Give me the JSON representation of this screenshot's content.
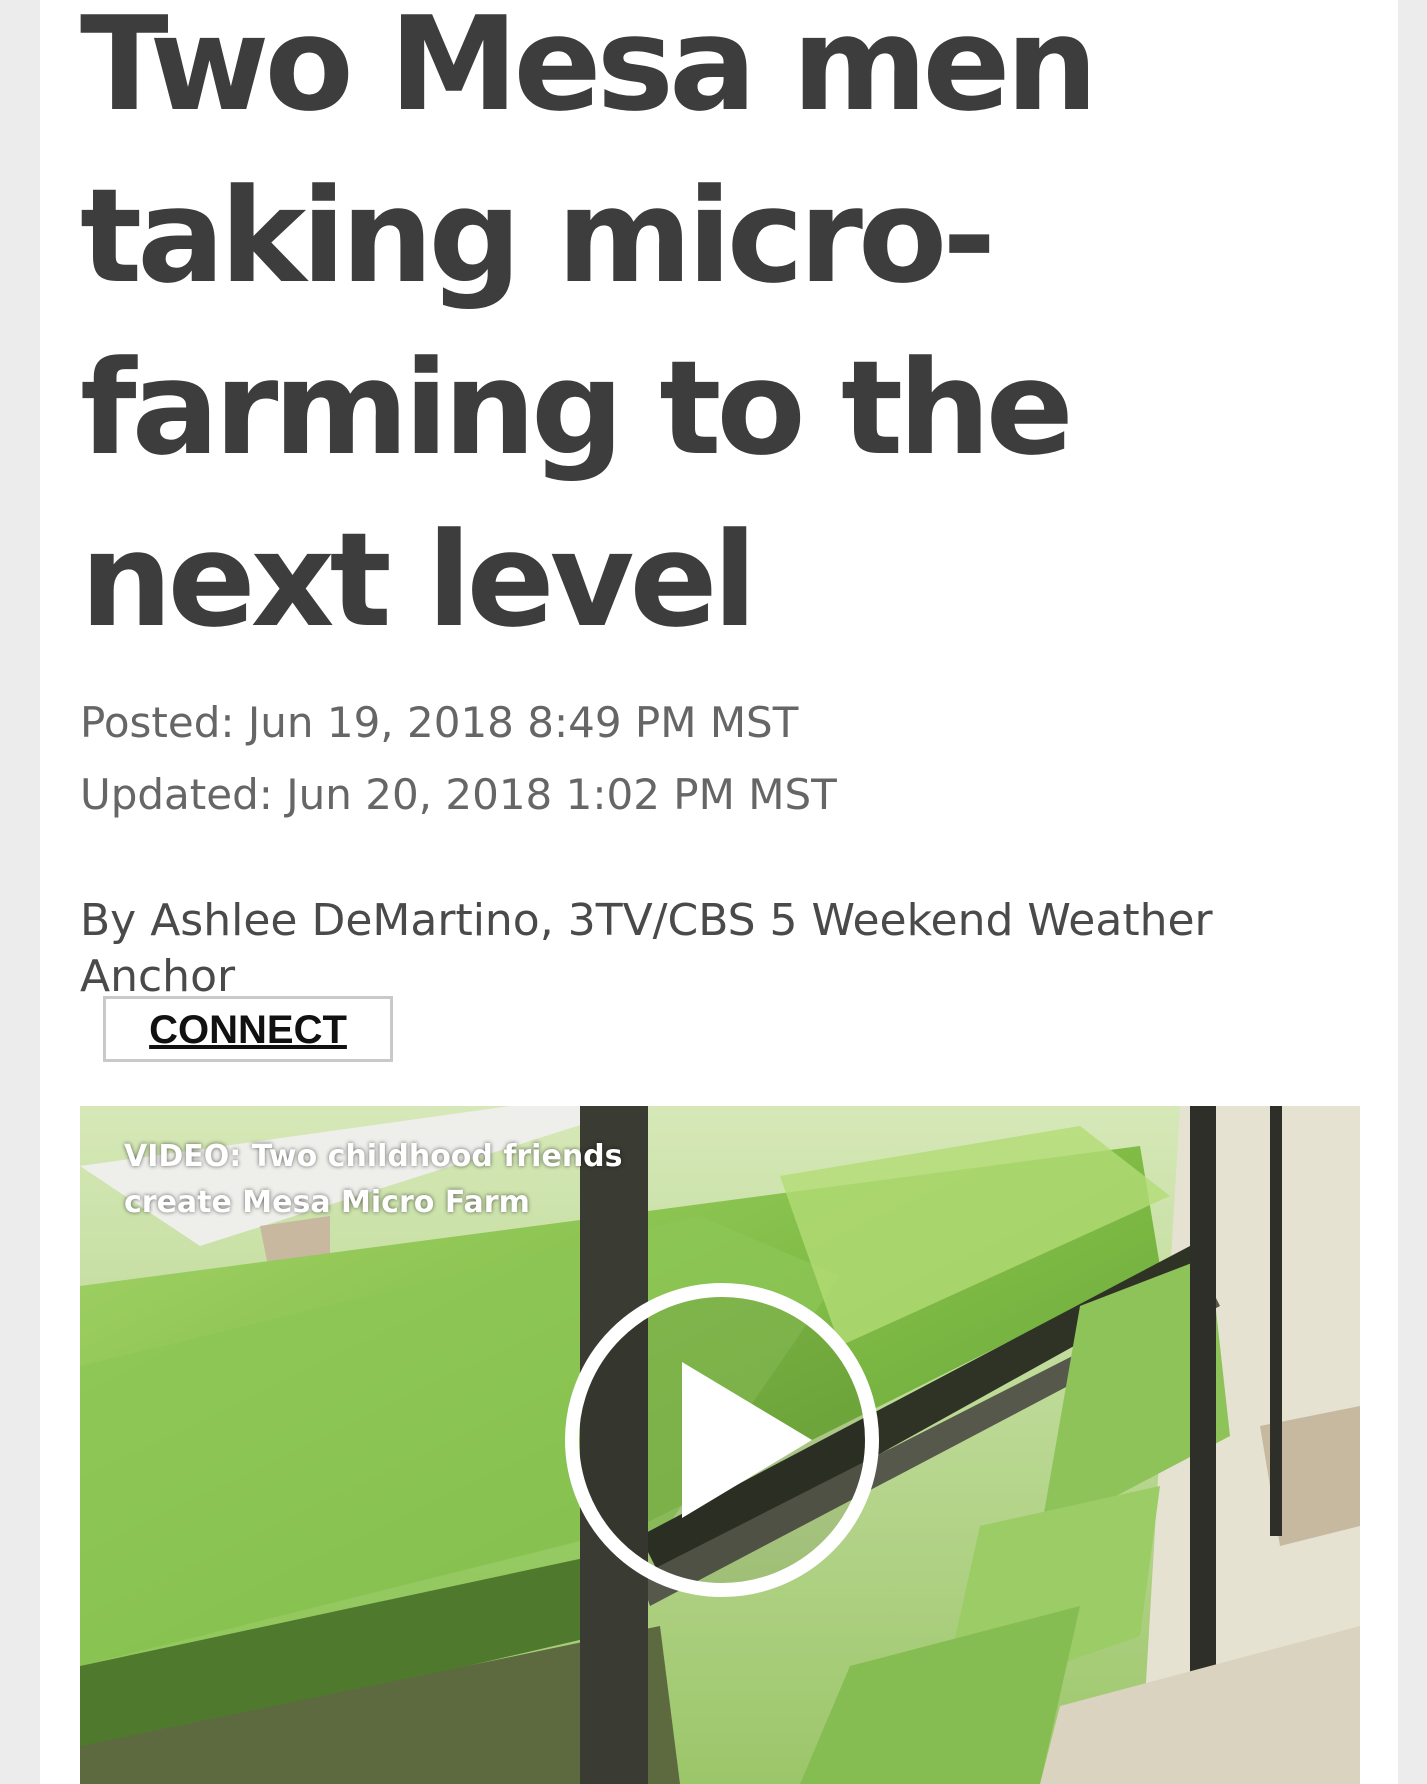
{
  "article": {
    "headline": "Two Mesa men taking micro-farming to the next level",
    "posted": "Posted: Jun 19, 2018 8:49 PM MST",
    "updated": "Updated: Jun 20, 2018 1:02 PM MST",
    "byline": "By Ashlee DeMartino, 3TV/CBS 5 Weekend Weather Anchor",
    "connect_label": "CONNECT"
  },
  "video": {
    "caption": "VIDEO: Two childhood friends create Mesa Micro Farm",
    "play_icon": "play-icon"
  },
  "colors": {
    "headline": "#3d3d3d",
    "meta": "#666666",
    "page_background": "#ffffff",
    "outer_background": "#ececec"
  }
}
